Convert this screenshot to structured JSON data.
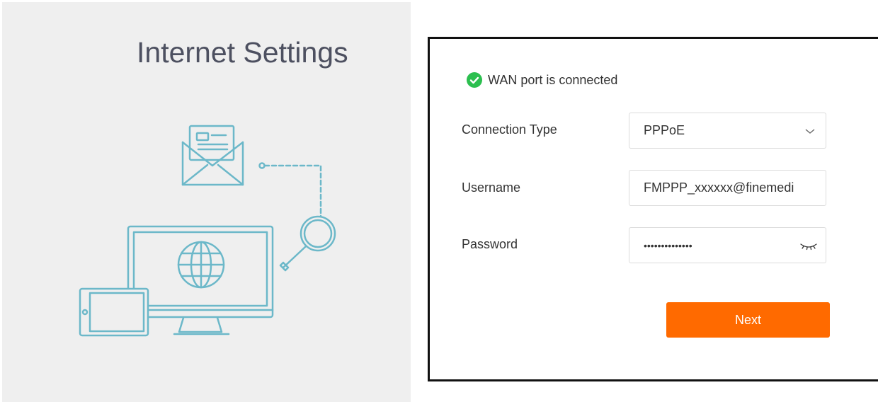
{
  "page": {
    "title": "Internet Settings"
  },
  "illustration": {
    "icons": [
      "envelope-icon",
      "magnifier-icon",
      "monitor-icon",
      "globe-icon",
      "tablet-icon"
    ],
    "color": "#6cb8c9"
  },
  "form": {
    "status": {
      "icon": "check-circle-icon",
      "text": "WAN port is connected",
      "color": "#2cbf4f"
    },
    "connection_type": {
      "label": "Connection Type",
      "value": "PPPoE"
    },
    "username": {
      "label": "Username",
      "value": "FMPPP_xxxxxx@finemedi"
    },
    "password": {
      "label": "Password",
      "value": "••••••••••••••"
    },
    "next_label": "Next",
    "accent": "#ff6a00"
  }
}
